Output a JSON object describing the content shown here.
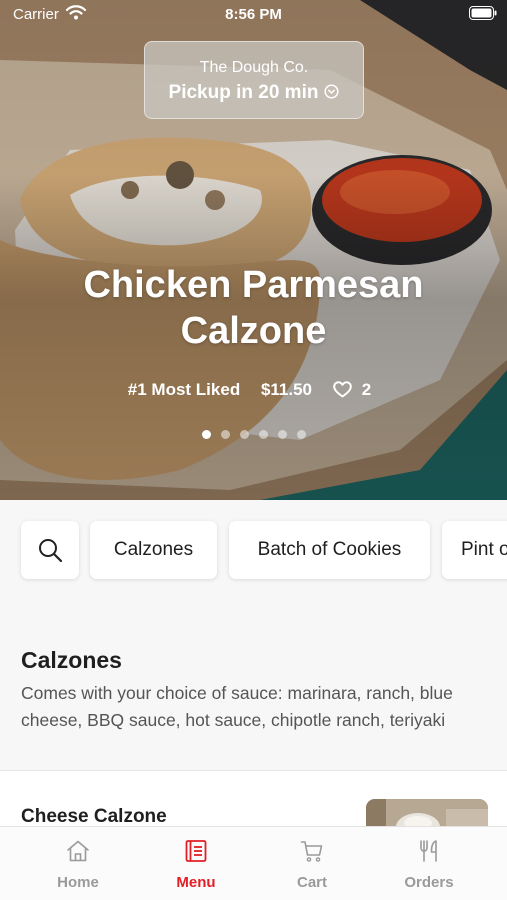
{
  "status_bar": {
    "carrier": "Carrier",
    "time": "8:56 PM"
  },
  "pickup": {
    "store": "The Dough Co.",
    "time_label": "Pickup in 20 min"
  },
  "featured": {
    "title_line1": "Chicken Parmesan",
    "title_line2": "Calzone",
    "badge": "#1 Most Liked",
    "price": "$11.50",
    "likes": "2",
    "slide_count": 6,
    "active_slide": 1
  },
  "categories": {
    "search_icon": "search-icon",
    "items": [
      "Calzones",
      "Batch of Cookies",
      "Pint of Ice Cream"
    ]
  },
  "section": {
    "title": "Calzones",
    "description": "Comes with your choice of sauce: marinara, ranch, blue cheese, BBQ sauce, hot sauce, chipotle ranch, teriyaki"
  },
  "menu_items": [
    {
      "name": "Cheese Calzone"
    }
  ],
  "tab_bar": {
    "active_color": "#e21f26",
    "tabs": [
      {
        "label": "Home",
        "icon": "home-icon"
      },
      {
        "label": "Menu",
        "icon": "menu-book-icon"
      },
      {
        "label": "Cart",
        "icon": "cart-icon"
      },
      {
        "label": "Orders",
        "icon": "fork-knife-icon"
      }
    ]
  }
}
